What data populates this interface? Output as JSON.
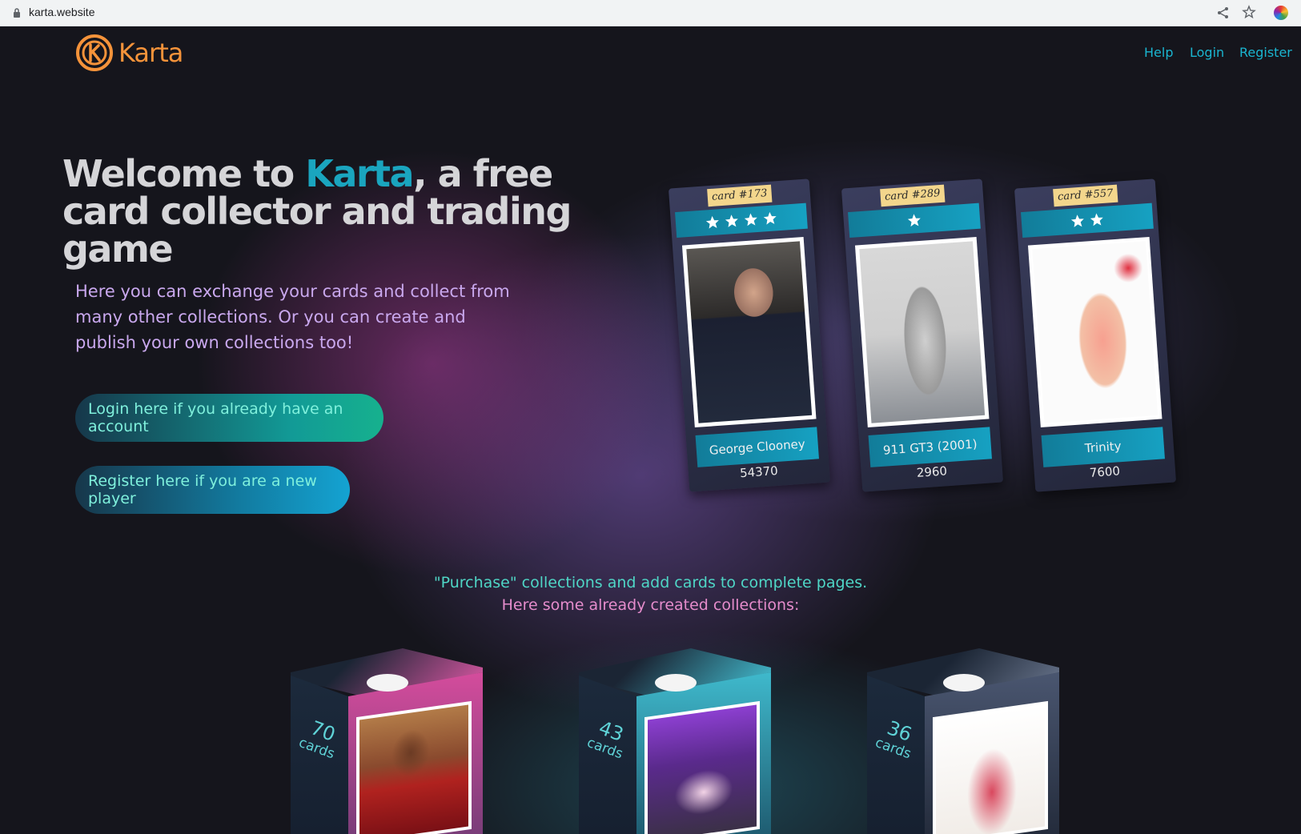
{
  "browser": {
    "url": "karta.website"
  },
  "header": {
    "logo_text": "Karta",
    "nav": {
      "help": "Help",
      "login": "Login",
      "register": "Register"
    }
  },
  "hero": {
    "title_before": "Welcome to ",
    "title_accent": "Karta",
    "title_after": ", a free card collector and trading game",
    "description": "Here you can exchange your cards and collect from many other collections. Or you can create and publish your own collections too!",
    "login_button": "Login here if you already have an account",
    "register_button": "Register here if you are a new player"
  },
  "cards": [
    {
      "number": "card #173",
      "stars": 4,
      "name": "George Clooney",
      "value": "54370"
    },
    {
      "number": "card #289",
      "stars": 1,
      "name": "911 GT3 (2001)",
      "value": "2960"
    },
    {
      "number": "card #557",
      "stars": 2,
      "name": "Trinity",
      "value": "7600"
    }
  ],
  "promo": {
    "line1": "\"Purchase\" collections and add cards to complete pages.",
    "line2": "Here some already created collections:"
  },
  "collections": [
    {
      "count": "70",
      "unit": "cards",
      "accent": "#e25aa8"
    },
    {
      "count": "43",
      "unit": "cards",
      "accent": "#45c6d9"
    },
    {
      "count": "36",
      "unit": "cards",
      "accent": "#6c7890"
    }
  ],
  "colors": {
    "logo": "#f5933a",
    "accent": "#1aa5bf",
    "link": "#1ab5d0"
  }
}
